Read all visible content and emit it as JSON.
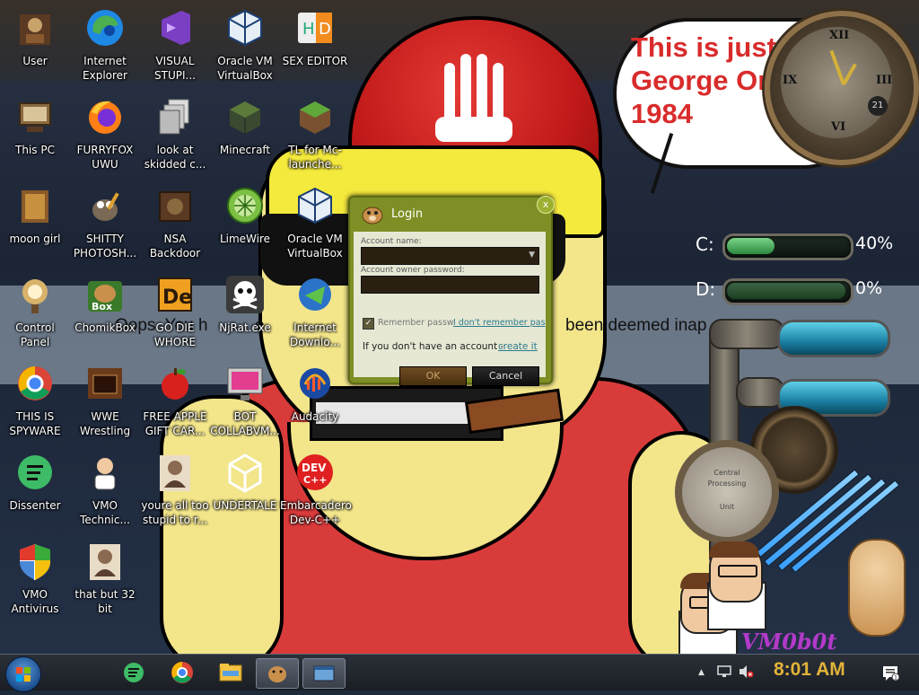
{
  "desktop": {
    "icons": [
      {
        "label": "User",
        "icon": "user-folder-icon"
      },
      {
        "label": "Internet Explorer",
        "icon": "edge-icon"
      },
      {
        "label": "VISUAL STUPI...",
        "icon": "visual-studio-icon"
      },
      {
        "label": "Oracle VM VirtualBox",
        "icon": "virtualbox-icon"
      },
      {
        "label": "SEX EDITOR",
        "icon": "hex-editor-icon"
      },
      {
        "label": "This PC",
        "icon": "this-pc-icon"
      },
      {
        "label": "FURRYFOX UWU",
        "icon": "firefox-icon"
      },
      {
        "label": "look at skidded c...",
        "icon": "copy-folder-icon"
      },
      {
        "label": "Minecraft",
        "icon": "minecraft-icon"
      },
      {
        "label": "TL for Mc-launche...",
        "icon": "minecraft-launcher-icon"
      },
      {
        "label": "moon girl",
        "icon": "file-icon"
      },
      {
        "label": "SHITTY PHOTOSH...",
        "icon": "gimp-icon"
      },
      {
        "label": "NSA Backdoor",
        "icon": "steampunk-box-icon"
      },
      {
        "label": "LimeWire",
        "icon": "limewire-icon"
      },
      {
        "label": "Oracle VM VirtualBox",
        "icon": "virtualbox-icon"
      },
      {
        "label": "Control Panel",
        "icon": "control-panel-icon"
      },
      {
        "label": "ChomikBox",
        "icon": "chomikbox-icon"
      },
      {
        "label": "GO DIE WHORE",
        "icon": "adobe-de-icon"
      },
      {
        "label": "NjRat.exe",
        "icon": "skull-icon"
      },
      {
        "label": "Internet Downlo...",
        "icon": "idm-icon"
      },
      {
        "label": "THIS IS SPYWARE",
        "icon": "chrome-icon"
      },
      {
        "label": "WWE Wrestling",
        "icon": "oven-icon"
      },
      {
        "label": "FREE APPLE GIFT CAR...",
        "icon": "apple-icon"
      },
      {
        "label": "BOT COLLABVM...",
        "icon": "monitor-icon"
      },
      {
        "label": "Audacity",
        "icon": "audacity-icon"
      },
      {
        "label": "Dissenter",
        "icon": "dissenter-icon"
      },
      {
        "label": "VMO Technic...",
        "icon": "technician-icon"
      },
      {
        "label": "youre all too stupid to r...",
        "icon": "portrait-icon"
      },
      {
        "label": "UNDERTALE",
        "icon": "unity-icon"
      },
      {
        "label": "Embarcadero Dev-C++",
        "icon": "devcpp-icon"
      },
      {
        "label": "VMO Antivirus",
        "icon": "shield-icon"
      },
      {
        "label": "that but 32 bit",
        "icon": "portrait-icon"
      }
    ]
  },
  "wallpaper": {
    "bubble_text": "This is just like George Orwell's 1984",
    "oops_left": "Oops. You h",
    "oops_mid": "e",
    "oops_right": "been deemed inap"
  },
  "widgets": {
    "clock_date": "21",
    "drives": [
      {
        "label": "C:",
        "percent_text": "40%",
        "percent": 40
      },
      {
        "label": "D:",
        "percent_text": "0%",
        "percent": 0
      }
    ],
    "gauge_text": [
      "Central",
      "Processing",
      "Unit"
    ],
    "vm_text": "VM0b0t"
  },
  "login": {
    "title": "Login",
    "close": "x",
    "account_name_label": "Account name:",
    "owner_password_label": "Account owner password:",
    "remember_label": "Remember passw",
    "forgot_link": "I don't remember pas",
    "info_text": "If you don't have an account -",
    "create_link": "create it",
    "ok_button": "OK",
    "cancel_button": "Cancel"
  },
  "taskbar": {
    "time": "8:01 AM",
    "start_icon": "windows-orb-icon",
    "pinned": [
      "dissenter-icon",
      "chrome-icon",
      "file-explorer-icon",
      "chomikbox-icon",
      "window-icon"
    ]
  },
  "colors": {
    "accent_login": "#7f8f25",
    "clock_text": "#e2b33a",
    "bubble_text": "#d92b2b"
  }
}
